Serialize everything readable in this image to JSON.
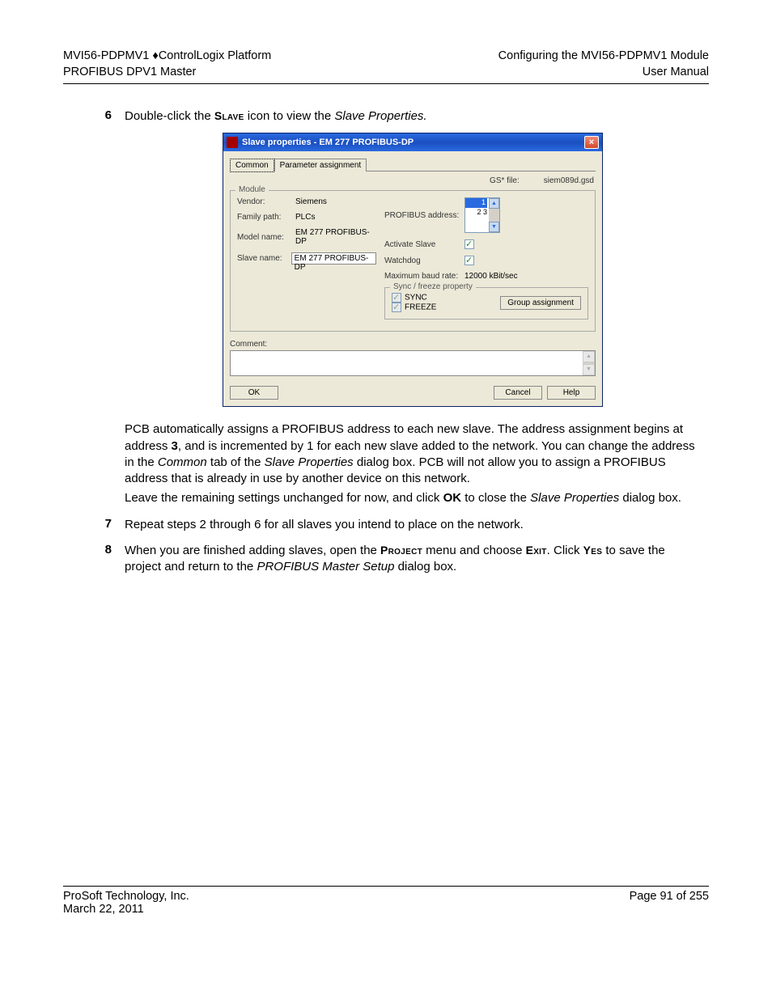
{
  "header": {
    "left1_a": "MVI56-PDPMV1",
    "left1_b": "ControlLogix Platform",
    "left2": "PROFIBUS DPV1 Master",
    "right1": "Configuring the MVI56-PDPMV1 Module",
    "right2": "User Manual"
  },
  "step6": {
    "num": "6",
    "pre": "Double-click the ",
    "slave_word": "Slave",
    "mid": " icon to view the ",
    "props": "Slave Properties.",
    "para2_a": "PCB automatically assigns a PROFIBUS address to each new slave. The address assignment begins at address ",
    "para2_bold3": "3",
    "para2_b": ", and is incremented by 1 for each new slave added to the network. You can change the address in the ",
    "para2_common": "Common",
    "para2_c": " tab of the ",
    "para2_sp": "Slave Properties",
    "para2_d": " dialog box. PCB will not allow you to assign a PROFIBUS address that is already in use by another device on this network.",
    "para3_a": "Leave the remaining settings unchanged for now, and click ",
    "para3_ok": "OK",
    "para3_b": " to close the ",
    "para3_sp": "Slave Properties",
    "para3_c": " dialog box."
  },
  "step7": {
    "num": "7",
    "txt": "Repeat steps 2 through 6 for all slaves you intend to place on the network."
  },
  "step8": {
    "num": "8",
    "a": "When you are finished adding slaves, open the ",
    "project": "Project",
    "b": " menu and choose ",
    "exit": "Exit",
    "c": ". Click ",
    "yes": "Yes",
    "d": " to save the project and return to the ",
    "pms": "PROFIBUS Master Setup",
    "e": " dialog box."
  },
  "dialog": {
    "title": "Slave properties - EM 277 PROFIBUS-DP",
    "tabs": {
      "common": "Common",
      "param": "Parameter assignment"
    },
    "gsfile_label": "GS* file:",
    "gsfile_value": "siem089d.gsd",
    "module_legend": "Module",
    "labels": {
      "vendor": "Vendor:",
      "family": "Family path:",
      "model": "Model name:",
      "slavename": "Slave name:",
      "pb_addr": "PROFIBUS address:",
      "activate": "Activate Slave",
      "watchdog": "Watchdog",
      "maxbaud": "Maximum baud rate:"
    },
    "values": {
      "vendor": "Siemens",
      "family": "PLCs",
      "model": "EM 277 PROFIBUS-DP",
      "slavename": "EM 277 PROFIBUS-DP",
      "maxbaud": "12000 kBit/sec"
    },
    "addr_opts": [
      "1",
      "2",
      "3"
    ],
    "syncfreeze": {
      "legend": "Sync / freeze property",
      "sync": "SYNC",
      "freeze": "FREEZE"
    },
    "group_btn": "Group assignment",
    "comment_label": "Comment:",
    "buttons": {
      "ok": "OK",
      "cancel": "Cancel",
      "help": "Help"
    }
  },
  "footer": {
    "left1": "ProSoft Technology, Inc.",
    "left2": "March 22, 2011",
    "right": "Page 91 of 255"
  }
}
